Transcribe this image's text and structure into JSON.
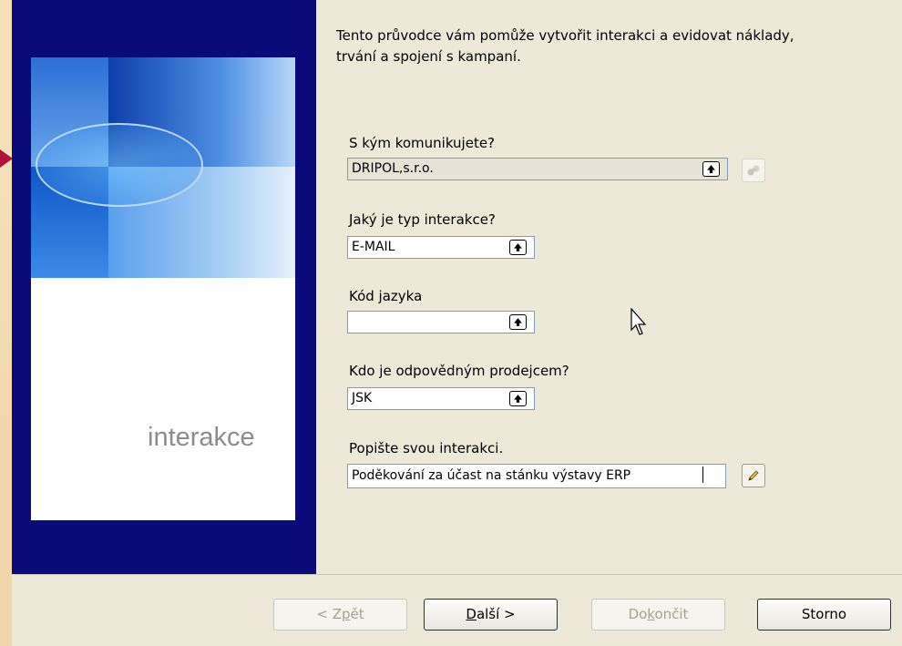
{
  "side": {
    "caption": "interakce"
  },
  "intro": {
    "line1": "Tento průvodce vám pomůže vytvořit interakci a evidovat náklady,",
    "line2": "trvání a spojení s kampaní."
  },
  "fields": {
    "contact": {
      "label": "S kým komunikujete?",
      "value": "DRIPOL,s.r.o."
    },
    "type": {
      "label": "Jaký je typ interakce?",
      "value": "E-MAIL"
    },
    "language": {
      "label": "Kód jazyka",
      "value": ""
    },
    "salesperson": {
      "label": "Kdo je odpovědným prodejcem?",
      "value": "JSK"
    },
    "description": {
      "label": "Popište svou interakci.",
      "value": "Poděkování za účast na stánku výstavy ERP"
    }
  },
  "buttons": {
    "back": {
      "prefix": "< Z",
      "accel": "p",
      "suffix": "ět"
    },
    "next": {
      "prefix": "",
      "accel": "D",
      "suffix": "alší >"
    },
    "finish": {
      "prefix": "Do",
      "accel": "k",
      "suffix": "ončit"
    },
    "cancel": {
      "label": "Storno"
    }
  },
  "icons": {
    "lookup": "arrow-up-icon",
    "assist": "binoculars-icon",
    "edit": "pencil-icon"
  }
}
